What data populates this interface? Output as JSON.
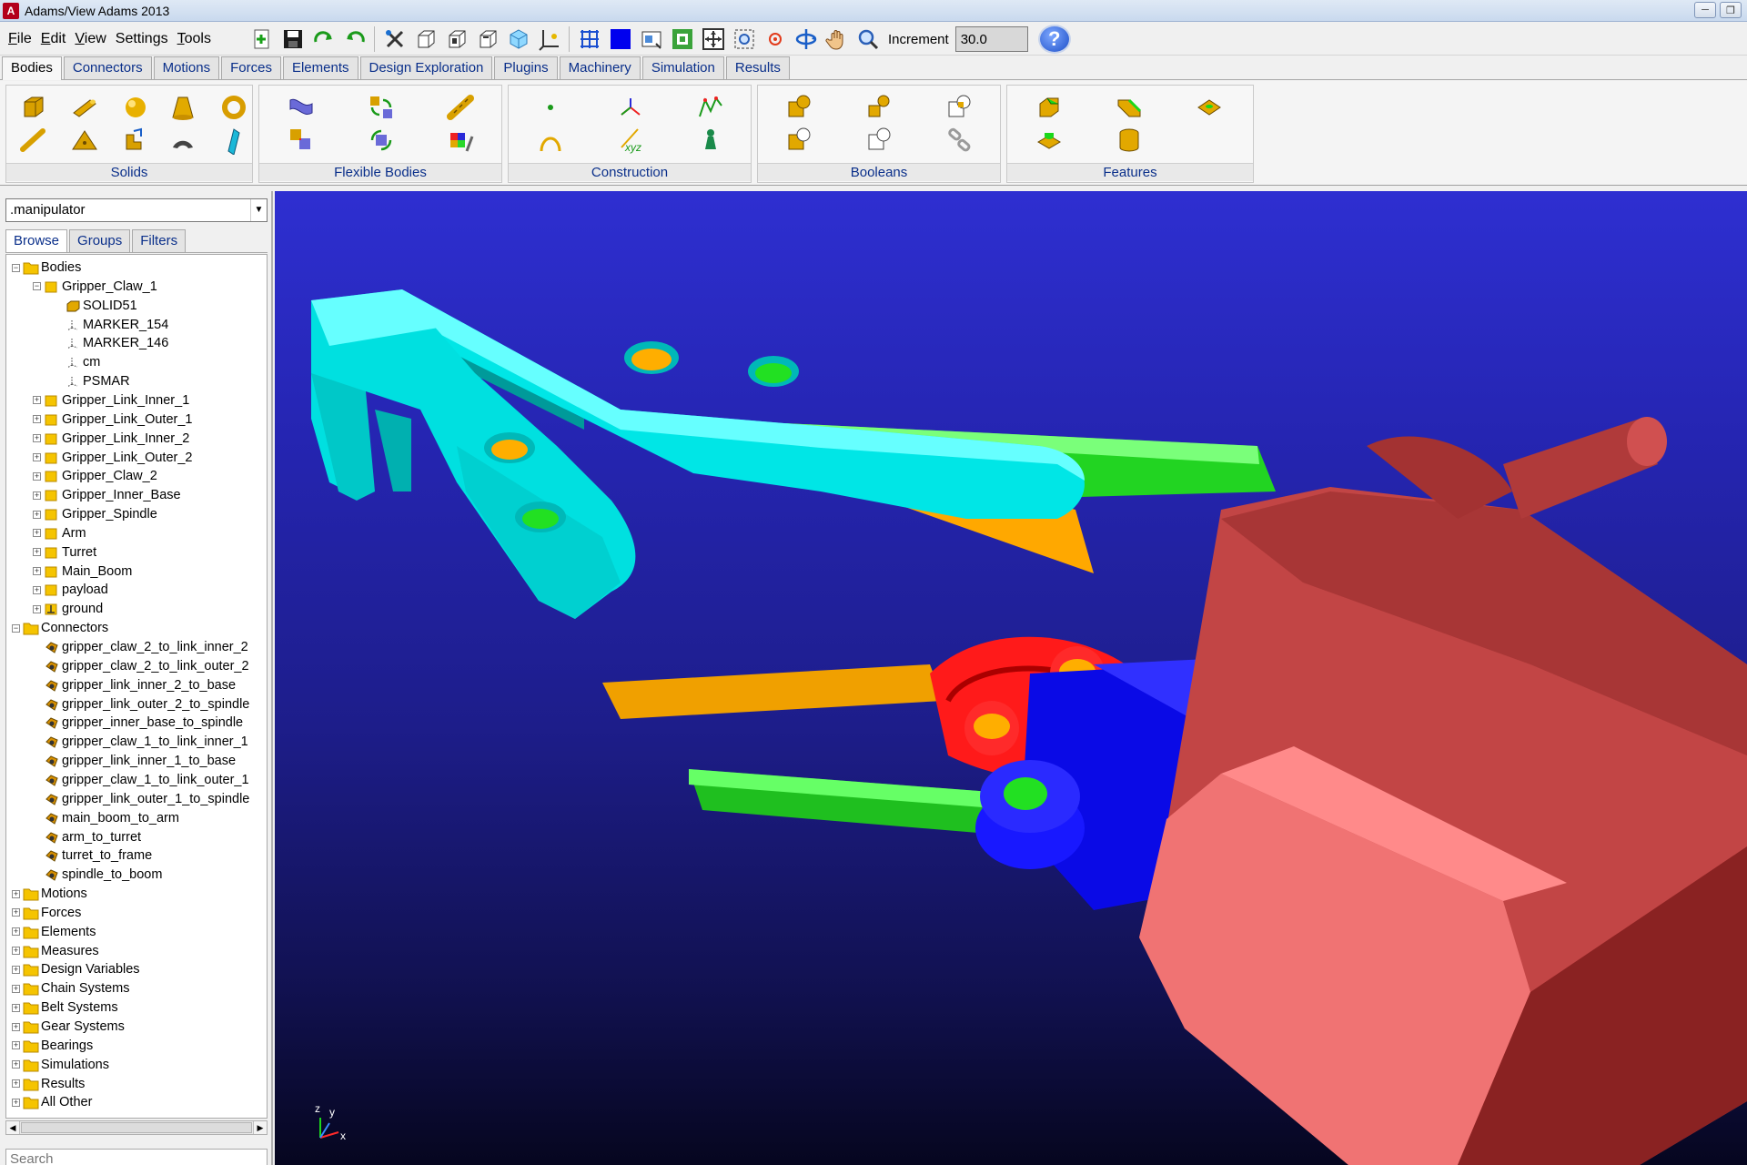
{
  "window": {
    "title": "Adams/View Adams 2013",
    "app_icon_letter": "A"
  },
  "menu": [
    {
      "u": "F",
      "rest": "ile"
    },
    {
      "u": "E",
      "rest": "dit"
    },
    {
      "u": "V",
      "rest": "iew"
    },
    {
      "u": "",
      "rest": "Settings"
    },
    {
      "u": "T",
      "rest": "ools"
    }
  ],
  "toolbar": {
    "increment_label": "Increment",
    "increment_value": "30.0",
    "help_label": "?"
  },
  "ribbon_tabs": [
    "Bodies",
    "Connectors",
    "Motions",
    "Forces",
    "Elements",
    "Design Exploration",
    "Plugins",
    "Machinery",
    "Simulation",
    "Results"
  ],
  "ribbon_active_tab": "Bodies",
  "ribbon_groups": {
    "solids": "Solids",
    "flexible": "Flexible Bodies",
    "construction": "Construction",
    "booleans": "Booleans",
    "features": "Features"
  },
  "browser": {
    "model": ".manipulator",
    "tabs": [
      "Browse",
      "Groups",
      "Filters"
    ],
    "active_tab": "Browse",
    "search_placeholder": "Search"
  },
  "tree": {
    "bodies_label": "Bodies",
    "gripper_claw_1": "Gripper_Claw_1",
    "claw_children": [
      "SOLID51",
      "MARKER_154",
      "MARKER_146",
      "cm",
      "PSMAR"
    ],
    "bodies": [
      "Gripper_Link_Inner_1",
      "Gripper_Link_Outer_1",
      "Gripper_Link_Inner_2",
      "Gripper_Link_Outer_2",
      "Gripper_Claw_2",
      "Gripper_Inner_Base",
      "Gripper_Spindle",
      "Arm",
      "Turret",
      "Main_Boom",
      "payload"
    ],
    "ground": "ground",
    "connectors_label": "Connectors",
    "connectors": [
      "gripper_claw_2_to_link_inner_2",
      "gripper_claw_2_to_link_outer_2",
      "gripper_link_inner_2_to_base",
      "gripper_link_outer_2_to_spindle",
      "gripper_inner_base_to_spindle",
      "gripper_claw_1_to_link_inner_1",
      "gripper_link_inner_1_to_base",
      "gripper_claw_1_to_link_outer_1",
      "gripper_link_outer_1_to_spindle",
      "main_boom_to_arm",
      "arm_to_turret",
      "turret_to_frame",
      "spindle_to_boom"
    ],
    "categories": [
      "Motions",
      "Forces",
      "Elements",
      "Measures",
      "Design Variables",
      "Chain Systems",
      "Belt Systems",
      "Gear Systems",
      "Bearings",
      "Simulations",
      "Results",
      "All Other"
    ]
  },
  "triad": {
    "z": "z",
    "y": "y",
    "x": "x"
  },
  "colors": {
    "claw": "#00ffff",
    "link_inner": "#ffb000",
    "link_outer": "#00ff00",
    "base": "#ff0000",
    "spindle": "#0000ff",
    "arm": "#c84a4a",
    "folder": "#f5c400"
  }
}
